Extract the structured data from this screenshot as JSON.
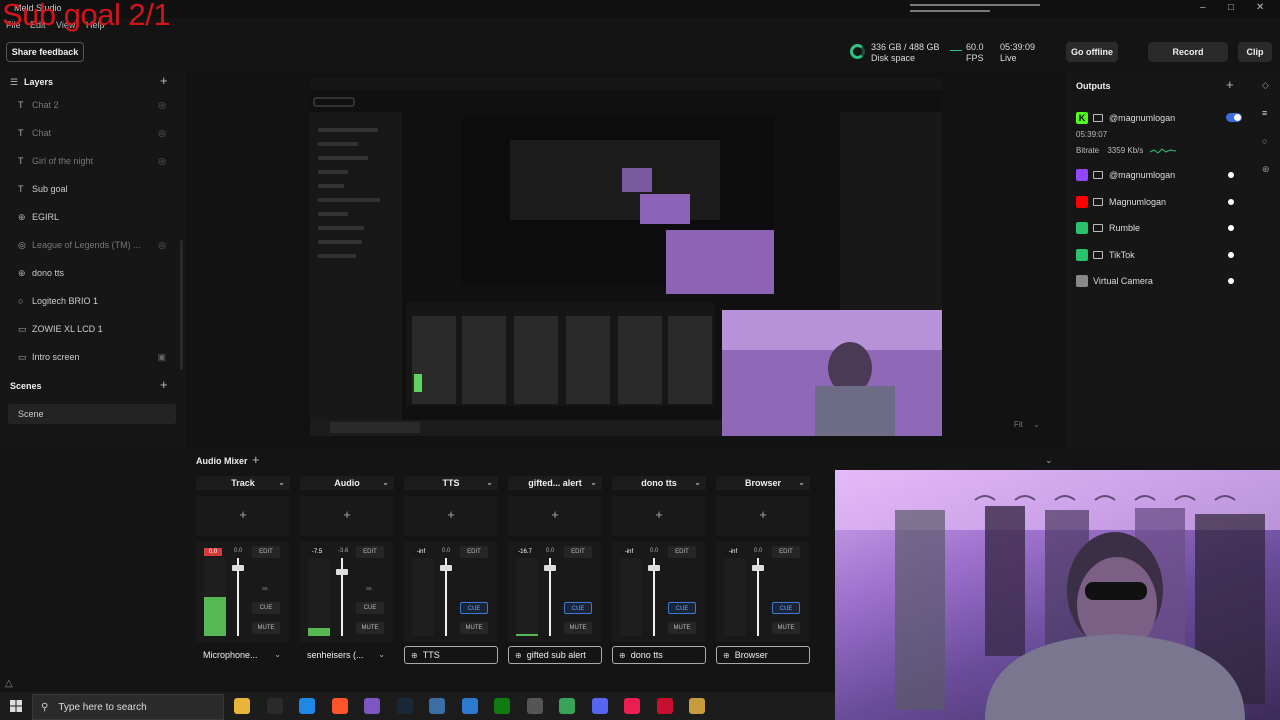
{
  "window": {
    "app_title": "Meld Studio",
    "overlay_text": "Sub goal 2/1",
    "menu": [
      "File",
      "Edit",
      "View",
      "Help"
    ]
  },
  "toolbar": {
    "feedback": "Share feedback",
    "disk_value": "336 GB / 488 GB",
    "disk_label": "Disk space",
    "fps_value": "60.0",
    "fps_label": "FPS",
    "live_time": "05:39:09",
    "live_label": "Live",
    "go_offline": "Go offline",
    "record": "Record",
    "clip": "Clip"
  },
  "layers": {
    "title": "Layers",
    "items": [
      {
        "label": "Chat 2",
        "icon": "text-icon",
        "dim": true
      },
      {
        "label": "Chat",
        "icon": "text-icon",
        "dim": true
      },
      {
        "label": "Girl of the night",
        "icon": "text-icon",
        "dim": true
      },
      {
        "label": "Sub goal",
        "icon": "text-icon",
        "dim": false
      },
      {
        "label": "EGIRL",
        "icon": "globe-icon",
        "dim": false
      },
      {
        "label": "League of Legends (TM) ...",
        "icon": "game-icon",
        "dim": true
      },
      {
        "label": "dono tts",
        "icon": "globe-icon",
        "dim": false
      },
      {
        "label": "Logitech BRIO 1",
        "icon": "camera-icon",
        "dim": false
      },
      {
        "label": "ZOWIE XL LCD 1",
        "icon": "monitor-icon",
        "dim": false
      },
      {
        "label": "Intro screen",
        "icon": "monitor-icon",
        "dim": false
      }
    ]
  },
  "scenes": {
    "title": "Scenes",
    "items": [
      "Scene"
    ]
  },
  "preview": {
    "fit": "Fit"
  },
  "outputs": {
    "title": "Outputs",
    "kick": {
      "name": "@magnumlogan",
      "time": "05:39:07",
      "bitrate_label": "Bitrate",
      "bitrate": "3359 Kb/s",
      "enabled": true
    },
    "items": [
      {
        "name": "@magnumlogan",
        "platform": "twitch",
        "color": "#9146ff"
      },
      {
        "name": "Magnumlogan",
        "platform": "youtube",
        "color": "#ff0000"
      },
      {
        "name": "Rumble",
        "platform": "rumble",
        "color": "#27c46b"
      },
      {
        "name": "TikTok",
        "platform": "tiktok",
        "color": "#27c46b"
      },
      {
        "name": "Virtual Camera",
        "platform": "virtual-camera",
        "color": "#888888"
      }
    ]
  },
  "mixer": {
    "title": "Audio Mixer",
    "tracks": [
      {
        "name": "Track",
        "peak": "0.0",
        "level": "0.0",
        "meter": 0.5,
        "fader": 0.9,
        "cue_active": false,
        "linked": true,
        "source": "Microphone...",
        "source_boxed": false
      },
      {
        "name": "Audio",
        "peak": "-7.5",
        "level": "-3.6",
        "meter": 0.1,
        "fader": 0.85,
        "cue_active": false,
        "linked": true,
        "source": "senheisers (...",
        "source_boxed": false
      },
      {
        "name": "TTS",
        "peak": "-inf",
        "level": "0.0",
        "meter": 0.0,
        "fader": 0.9,
        "cue_active": true,
        "linked": false,
        "source": "TTS",
        "source_boxed": true
      },
      {
        "name": "gifted... alert",
        "peak": "-16.7",
        "level": "0.0",
        "meter": 0.03,
        "fader": 0.9,
        "cue_active": true,
        "linked": false,
        "source": "gifted sub alert",
        "source_boxed": true
      },
      {
        "name": "dono tts",
        "peak": "-inf",
        "level": "0.0",
        "meter": 0.0,
        "fader": 0.9,
        "cue_active": true,
        "linked": false,
        "source": "dono tts",
        "source_boxed": true
      },
      {
        "name": "Browser",
        "peak": "-inf",
        "level": "0.0",
        "meter": 0.0,
        "fader": 0.9,
        "cue_active": true,
        "linked": false,
        "source": "Browser",
        "source_boxed": true
      }
    ],
    "edit": "EDIT",
    "cue": "CUE",
    "mute": "MUTE"
  },
  "taskbar": {
    "search_placeholder": "Type here to search",
    "apps": [
      {
        "name": "file-explorer-icon",
        "color": "#e8b43a"
      },
      {
        "name": "epic-games-icon",
        "color": "#2a2a2a"
      },
      {
        "name": "edge-icon",
        "color": "#1e88e5"
      },
      {
        "name": "brave-icon",
        "color": "#fb542b"
      },
      {
        "name": "chrome-icon",
        "color": "#7e57c2"
      },
      {
        "name": "steam-icon",
        "color": "#1b2838"
      },
      {
        "name": "meld-icon",
        "color": "#3a6ea5"
      },
      {
        "name": "store-icon",
        "color": "#2d7bd1"
      },
      {
        "name": "xbox-icon",
        "color": "#107c10"
      },
      {
        "name": "riot-icon",
        "color": "#555"
      },
      {
        "name": "notepad-icon",
        "color": "#3aa35a"
      },
      {
        "name": "discord-icon",
        "color": "#5865f2"
      },
      {
        "name": "tiktok-icon",
        "color": "#ee1d52"
      },
      {
        "name": "lol-icon",
        "color": "#c8102e"
      },
      {
        "name": "league-client-icon",
        "color": "#c89b3c"
      }
    ]
  }
}
